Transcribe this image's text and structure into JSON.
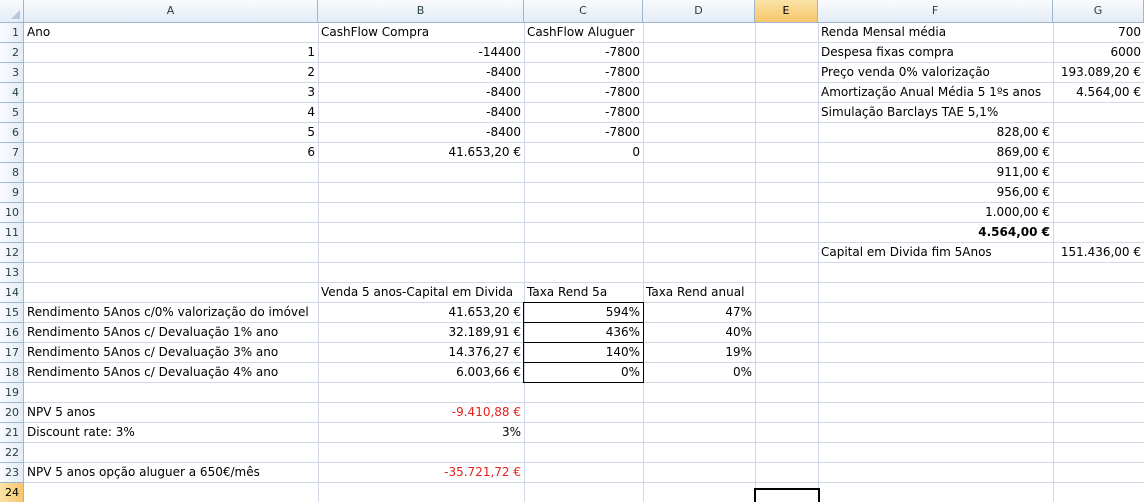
{
  "columns": [
    "A",
    "B",
    "C",
    "D",
    "E",
    "F",
    "G"
  ],
  "selected_column": "E",
  "rows": [
    "1",
    "2",
    "3",
    "4",
    "5",
    "6",
    "7",
    "8",
    "9",
    "10",
    "11",
    "12",
    "13",
    "14",
    "15",
    "16",
    "17",
    "18",
    "19",
    "20",
    "21",
    "22",
    "23",
    "24"
  ],
  "selected_row": "24",
  "cells": {
    "A1": "Ano",
    "B1": "CashFlow Compra",
    "C1": "CashFlow Aluguer",
    "A2": "1",
    "B2": "-14400",
    "C2": "-7800",
    "A3": "2",
    "B3": "-8400",
    "C3": "-7800",
    "A4": "3",
    "B4": "-8400",
    "C4": "-7800",
    "A5": "4",
    "B5": "-8400",
    "C5": "-7800",
    "A6": "5",
    "B6": "-8400",
    "C6": "-7800",
    "A7": "6",
    "B7": "41.653,20 €",
    "C7": "0",
    "F1": "Renda Mensal média",
    "G1": "700",
    "F2": "Despesa fixas compra",
    "G2": "6000",
    "F3": "Preço venda 0% valorização",
    "G3": "193.089,20 €",
    "F4": "Amortização Anual Média 5 1ºs anos",
    "G4": "4.564,00 €",
    "F5": "Simulação Barclays TAE 5,1%",
    "F6": "828,00 €",
    "F7": "869,00 €",
    "F8": "911,00 €",
    "F9": "956,00 €",
    "F10": "1.000,00 €",
    "F11": "4.564,00 €",
    "F12": "Capital em Divida fim 5Anos",
    "G12": "151.436,00 €",
    "B14": "Venda 5 anos-Capital em Divida",
    "C14": "Taxa Rend 5a",
    "D14": "Taxa Rend anual",
    "A15": "Rendimento 5Anos c/0% valorização do imóvel",
    "B15": "41.653,20 €",
    "C15": "594%",
    "D15": "47%",
    "A16": "Rendimento 5Anos c/ Devaluação 1% ano",
    "B16": "32.189,91 €",
    "C16": "436%",
    "D16": "40%",
    "A17": "Rendimento 5Anos c/ Devaluação 3% ano",
    "B17": "14.376,27 €",
    "C17": "140%",
    "D17": "19%",
    "A18": "Rendimento 5Anos c/ Devaluação 4% ano",
    "B18": "6.003,66 €",
    "C18": "0%",
    "D18": "0%",
    "A20": "NPV 5 anos",
    "B20": "-9.410,88 €",
    "A21": "Discount rate: 3%",
    "B21": "3%",
    "A23": "NPV 5 anos opção aluguer a 650€/mês",
    "B23": "-35.721,72 €"
  },
  "colors": {
    "header_bg": "#e4ecf7",
    "grid": "#d0d7e5",
    "negative": "#e8201c",
    "selected_header": "#f6c66b"
  }
}
